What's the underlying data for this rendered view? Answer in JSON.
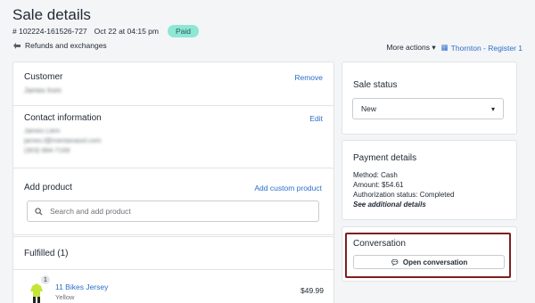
{
  "header": {
    "title": "Sale details",
    "order_id": "# 102224-161526-727",
    "datetime": "Oct 22 at 04:15 pm",
    "status_badge": "Paid",
    "refunds_link": "Refunds and exchanges",
    "more_actions": "More actions",
    "register_link": "Thornton - Register 1"
  },
  "customer": {
    "title": "Customer",
    "remove_label": "Remove",
    "name": "James Irom"
  },
  "contact": {
    "title": "Contact information",
    "edit_label": "Edit",
    "lines": [
      "James Liem",
      "james.l@mentanasol.com",
      "(303) 684-7169"
    ]
  },
  "add_product": {
    "title": "Add product",
    "custom_label": "Add custom product",
    "search_placeholder": "Search and add product"
  },
  "fulfilled": {
    "title": "Fulfilled (1)",
    "item_name": "11 Bikes Jersey",
    "item_variant": "Yellow",
    "item_price": "$49.99",
    "item_qty": "1"
  },
  "sale_status": {
    "title": "Sale status",
    "selected": "New"
  },
  "payment": {
    "title": "Payment details",
    "method": "Method: Cash",
    "amount": "Amount: $54.61",
    "auth": "Authorization status: Completed",
    "see_more": "See additional details"
  },
  "conversation": {
    "title": "Conversation",
    "button_label": "Open conversation"
  },
  "colors": {
    "link": "#2c6ecb",
    "paid_badge": "#8ee6d5",
    "highlight": "#7e1f1f"
  }
}
